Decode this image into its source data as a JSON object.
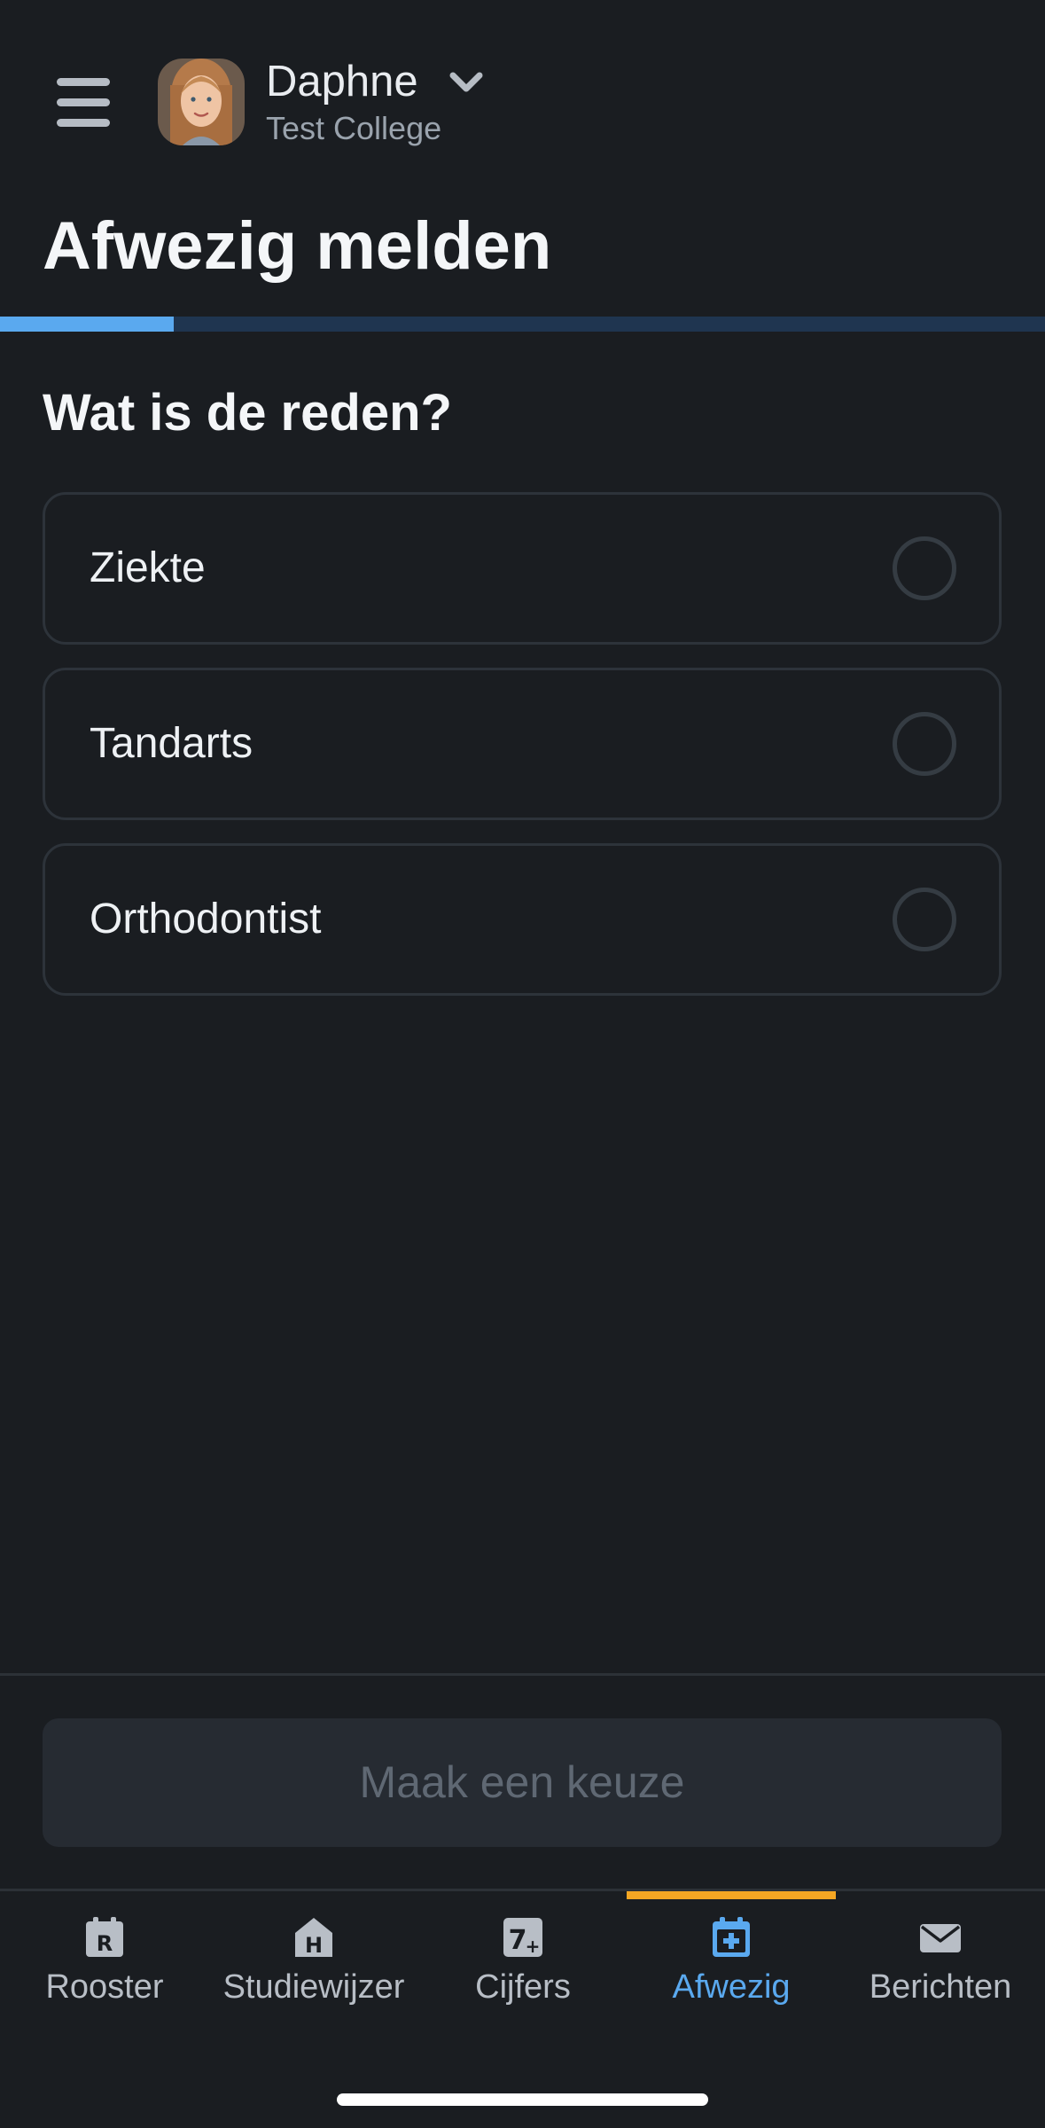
{
  "header": {
    "menu_icon": "hamburger-menu-icon",
    "user_name": "Daphne",
    "user_school": "Test College",
    "chevron_icon": "chevron-down-icon",
    "page_title": "Afwezig melden"
  },
  "progress": {
    "fraction": 0.166,
    "fill_color": "#5aa9ef",
    "track_color": "#1f3550"
  },
  "question": "Wat is de reden?",
  "options": [
    {
      "label": "Ziekte",
      "selected": false
    },
    {
      "label": "Tandarts",
      "selected": false
    },
    {
      "label": "Orthodontist",
      "selected": false
    }
  ],
  "submit_button": {
    "label": "Maak een keuze",
    "enabled": false
  },
  "bottom_nav": {
    "items": [
      {
        "label": "Rooster",
        "icon": "calendar-r-icon",
        "active": false
      },
      {
        "label": "Studiewijzer",
        "icon": "house-h-icon",
        "active": false
      },
      {
        "label": "Cijfers",
        "icon": "grade-7-plus-icon",
        "active": false
      },
      {
        "label": "Afwezig",
        "icon": "calendar-plus-icon",
        "active": true
      },
      {
        "label": "Berichten",
        "icon": "envelope-icon",
        "active": false
      }
    ],
    "active_color": "#5aa9ef",
    "indicator_color": "#f5a623"
  },
  "colors": {
    "background": "#1a1d21",
    "accent": "#5aa9ef"
  }
}
